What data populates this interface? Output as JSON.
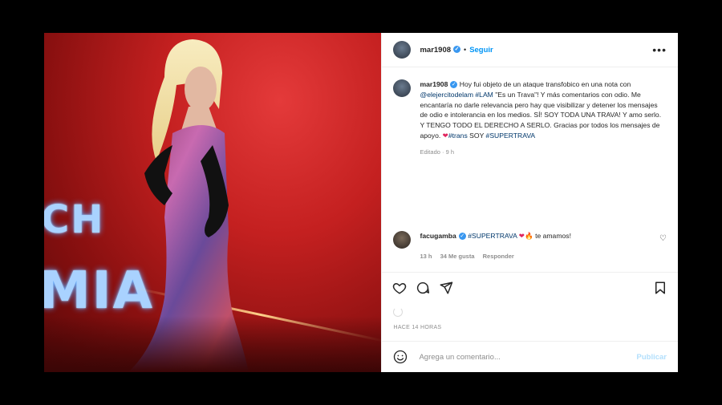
{
  "post": {
    "username": "mar1908",
    "follow_label": "Seguir",
    "more_label": "•••"
  },
  "photo": {
    "stage_text_1": "CH",
    "stage_text_2": "MIA"
  },
  "caption": {
    "username": "mar1908",
    "text_1": "Hoy fui objeto de un ataque transfobico en una nota con",
    "mention": "@elejercitodelam",
    "hashtag_lam": "#LAM",
    "text_2": "\"Es un Trava\"! Y más comentarios con odio. Me encantaría no darle relevancia pero hay que visibilizar y detener los mensajes de odio e intolerancia en los medios. SÍ! SOY TODA UNA TRAVA! Y amo serlo. Y TENGO TODO EL DERECHO A SERLO. Gracias por todos los mensajes de apoyo.",
    "hashtag_trans": "#trans",
    "text_3": "SOY",
    "hashtag_supertrava": "#SUPERTRAVA",
    "edited": "Editado · 9 h"
  },
  "comment": {
    "username": "facugamba",
    "hashtag": "#SUPERTRAVA",
    "text": "te amamos!",
    "age": "13 h",
    "likes": "34 Me gusta",
    "reply_label": "Responder"
  },
  "footer": {
    "time_ago": "HACE 14 HORAS",
    "input_placeholder": "Agrega un comentario...",
    "publish_label": "Publicar"
  },
  "colors": {
    "accent": "#0095f6",
    "verified": "#3897f0",
    "heart": "#e0245e"
  }
}
